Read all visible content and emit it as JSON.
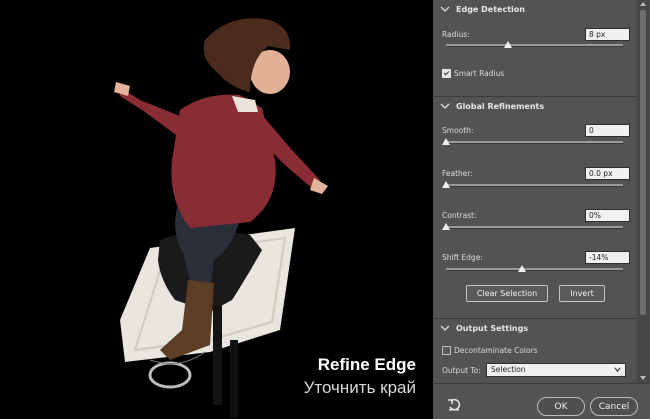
{
  "caption": {
    "title": "Refine Edge",
    "subtitle": "Уточнить край"
  },
  "panel": {
    "edge_detection": {
      "title": "Edge Detection",
      "radius_label": "Radius:",
      "radius_value": "8 px",
      "radius_level": 0.35,
      "smart_radius_label": "Smart Radius",
      "smart_radius_checked": true
    },
    "global_refinements": {
      "title": "Global Refinements",
      "smooth_label": "Smooth:",
      "smooth_value": "0",
      "feather_label": "Feather:",
      "feather_value": "0.0 px",
      "contrast_label": "Contrast:",
      "contrast_value": "0%",
      "shift_edge_label": "Shift Edge:",
      "shift_edge_value": "-14%",
      "shift_edge_level": 0.43
    },
    "buttons": {
      "clear_selection": "Clear Selection",
      "invert": "Invert"
    },
    "output_settings": {
      "title": "Output Settings",
      "decontaminate_label": "Decontaminate Colors",
      "decontaminate_checked": false,
      "output_to_label": "Output To:",
      "output_to_value": "Selection"
    },
    "footer": {
      "reset_icon": "reset-icon",
      "ok_label": "OK",
      "cancel_label": "Cancel"
    }
  }
}
